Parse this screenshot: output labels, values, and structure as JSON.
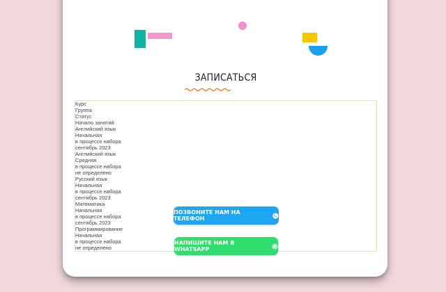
{
  "section": {
    "title": "ЗАПИСАТЬСЯ"
  },
  "table": {
    "headers": [
      "Курс",
      "Группа",
      "Статус",
      "Начало занятий"
    ],
    "rows": [
      [
        "Английский язык",
        "Начальная",
        "в процессе набора",
        "сентябрь 2023"
      ],
      [
        "Английский язык",
        "Средняя",
        "в процессе набора",
        "не определено"
      ],
      [
        "Русский язык",
        "Начальная",
        "в процессе набора",
        "сентябрь 2023"
      ],
      [
        "Математика",
        "Начальная",
        "в процессе набора",
        "сентябрь 2023"
      ],
      [
        "Программирование",
        "Начальная",
        "в процессе набора",
        "не определено"
      ]
    ]
  },
  "buttons": {
    "phone": {
      "label": "ПОЗВОНИТЕ НАМ НА ТЕЛЕФОН",
      "icon": "phone-icon",
      "color": "#1da7f0"
    },
    "whatsapp": {
      "label": "НАПИШИТЕ НАМ В WHATSAPP",
      "icon": "whatsapp-icon",
      "color": "#2fdc6e"
    }
  },
  "colors": {
    "background": "#f1d8dd",
    "table_header": "#fde98a",
    "table_row": "#fdf8e6",
    "title_underline": "#f07a2a"
  }
}
